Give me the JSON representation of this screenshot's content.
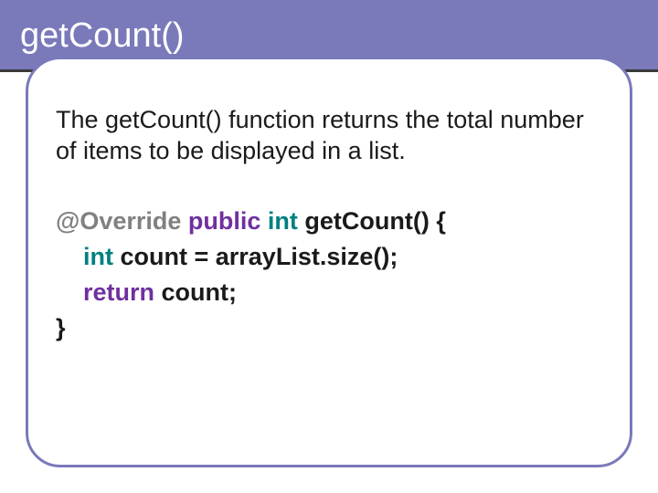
{
  "header": {
    "title": "getCount()"
  },
  "body": {
    "description": "The getCount() function returns the total number of items to be displayed in a list."
  },
  "code": {
    "line1": {
      "annotation": "@Override",
      "kw_public": "public",
      "kw_int": "int",
      "rest": " getCount() {"
    },
    "line2": {
      "kw_int": "int",
      "rest": " count = arrayList.size();"
    },
    "line3": {
      "kw_return": "return",
      "rest": " count;"
    },
    "line4": {
      "brace": "}"
    }
  }
}
